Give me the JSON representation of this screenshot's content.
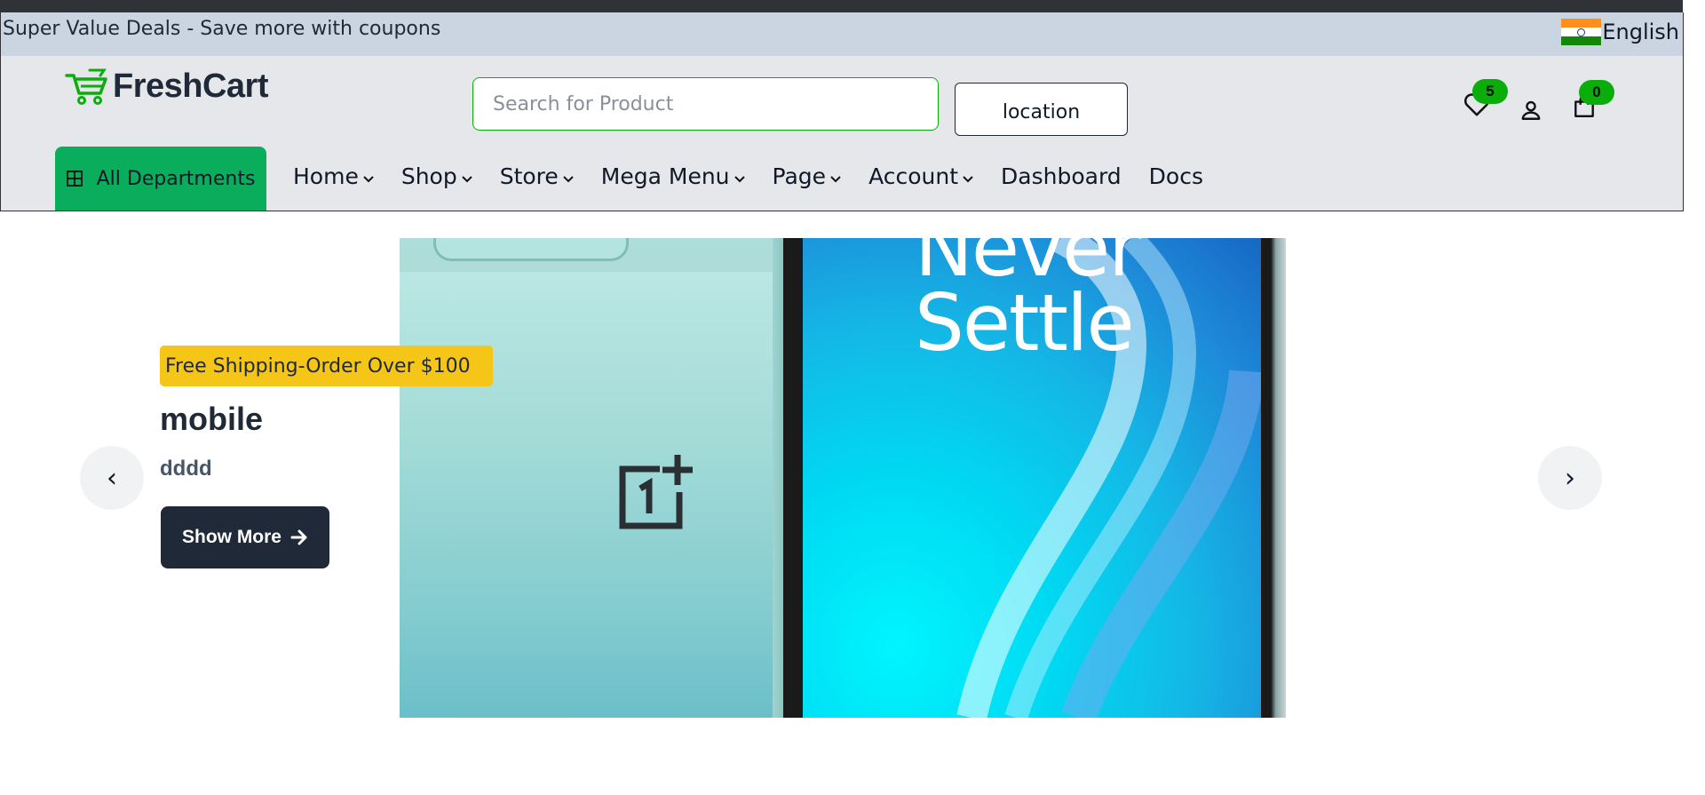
{
  "promo": {
    "text": "Super Value Deals - Save more with coupons"
  },
  "language": {
    "label": "English",
    "flag": "india-flag"
  },
  "brand": {
    "name": "FreshCart",
    "accent": "#0aad0a"
  },
  "search": {
    "placeholder": "Search for Product",
    "value": ""
  },
  "location": {
    "label": "location"
  },
  "header_icons": {
    "wishlist_count": "5",
    "cart_count": "0"
  },
  "nav": {
    "departments_label": "All Departments",
    "items": [
      {
        "label": "Home",
        "dropdown": true
      },
      {
        "label": "Shop",
        "dropdown": true
      },
      {
        "label": "Store",
        "dropdown": true
      },
      {
        "label": "Mega Menu",
        "dropdown": true
      },
      {
        "label": "Page",
        "dropdown": true
      },
      {
        "label": "Account",
        "dropdown": true
      },
      {
        "label": "Dashboard",
        "dropdown": false
      },
      {
        "label": "Docs",
        "dropdown": false
      }
    ]
  },
  "hero": {
    "badge": "Free Shipping-Order Over $100",
    "title": "mobile",
    "subtitle": "dddd",
    "button_label": "Show More",
    "image_text_line1": "Never",
    "image_text_line2": "Settle",
    "prev_label": "‹",
    "next_label": "›"
  }
}
